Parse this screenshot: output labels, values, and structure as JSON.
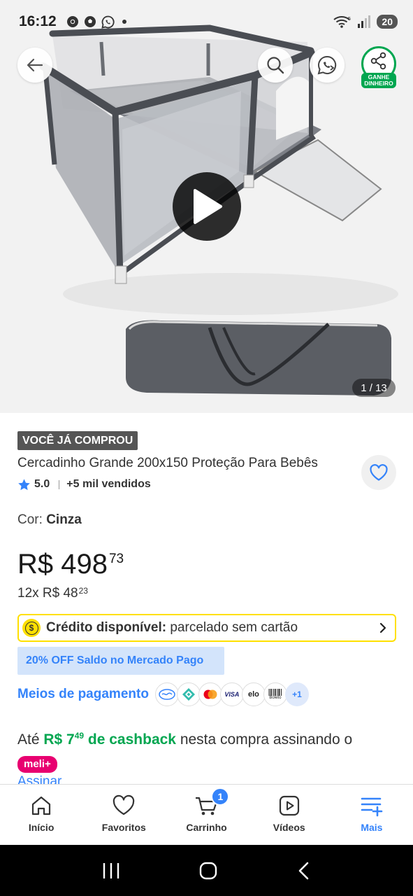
{
  "status_bar": {
    "time": "16:12",
    "battery": "20",
    "app_icons": [
      "chrome-icon",
      "soccer-ball-icon",
      "whatsapp-icon"
    ]
  },
  "gallery": {
    "counter": "1 / 13",
    "earn_label": "GANHE\nDINHEIRO"
  },
  "product": {
    "badge": "VOCÊ JÁ COMPROU",
    "title": "Cercadinho Grande 200x150 Proteção Para Bebês",
    "rating": "5.0",
    "sold": "+5 mil vendidos",
    "color_label": "Cor: ",
    "color_value": "Cinza",
    "price_main": "R$ 498",
    "price_cents": "73",
    "installments_main": "12x R$ 48",
    "installments_cents": "23"
  },
  "credit": {
    "bold": "Crédito disponível:",
    "rest": " parcelado sem cartão"
  },
  "promo": "20% OFF Saldo no Mercado Pago",
  "payment": {
    "link": "Meios de pagamento",
    "more": "+1",
    "methods": [
      "mercado-pago-icon",
      "pix-icon",
      "mastercard-icon",
      "visa-icon",
      "elo-icon",
      "boleto-icon"
    ],
    "visa": "VISA",
    "elo": "elo",
    "boleto": "Boleto"
  },
  "cashback": {
    "prefix": "Até ",
    "amount": "R$ 7",
    "amount_cents": "49",
    "suffix_green": " de cashback",
    "suffix": " nesta compra assinando o ",
    "badge": "meli+"
  },
  "subscribe": "Assinar",
  "bottom_nav": {
    "items": [
      {
        "label": "Início"
      },
      {
        "label": "Favoritos"
      },
      {
        "label": "Carrinho",
        "badge": "1"
      },
      {
        "label": "Vídeos"
      },
      {
        "label": "Mais"
      }
    ]
  },
  "colors": {
    "accent_blue": "#3483fa",
    "green": "#00a650",
    "yellow": "#ffe000",
    "meli_pink": "#e80070"
  }
}
